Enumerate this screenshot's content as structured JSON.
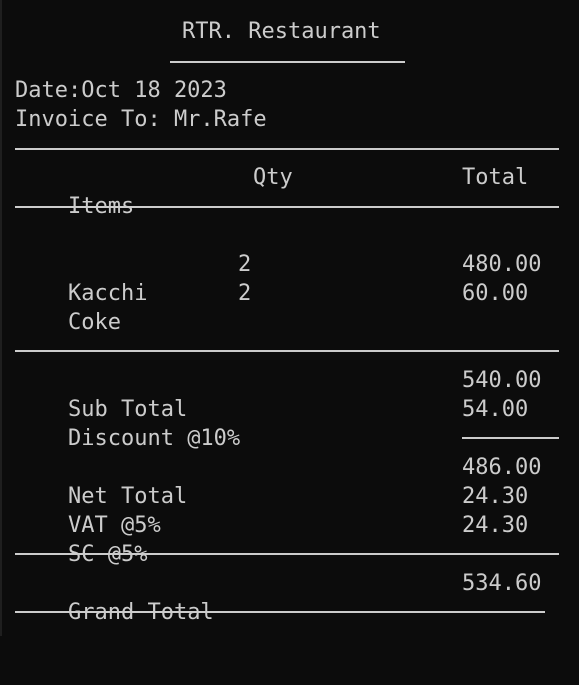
{
  "restaurant": "RTR. Restaurant",
  "date_line": "Date:Oct 18 2023",
  "invoice_line": "Invoice To: Mr.Rafe",
  "columns": {
    "items": "Items",
    "qty": "Qty",
    "total": "Total"
  },
  "items": [
    {
      "name": "Kacchi",
      "qty": "2",
      "total": "480.00"
    },
    {
      "name": "Coke",
      "qty": "2",
      "total": "60.00"
    }
  ],
  "summary": {
    "subtotal_label": "Sub Total",
    "subtotal": "540.00",
    "discount_label": "Discount @10%",
    "discount": "54.00",
    "net_label": "Net Total",
    "net": "486.00",
    "vat_label": "VAT @5%",
    "vat": "24.30",
    "sc_label": "SC @5%",
    "sc": "24.30",
    "grand_label": "Grand Total",
    "grand": "534.60"
  }
}
